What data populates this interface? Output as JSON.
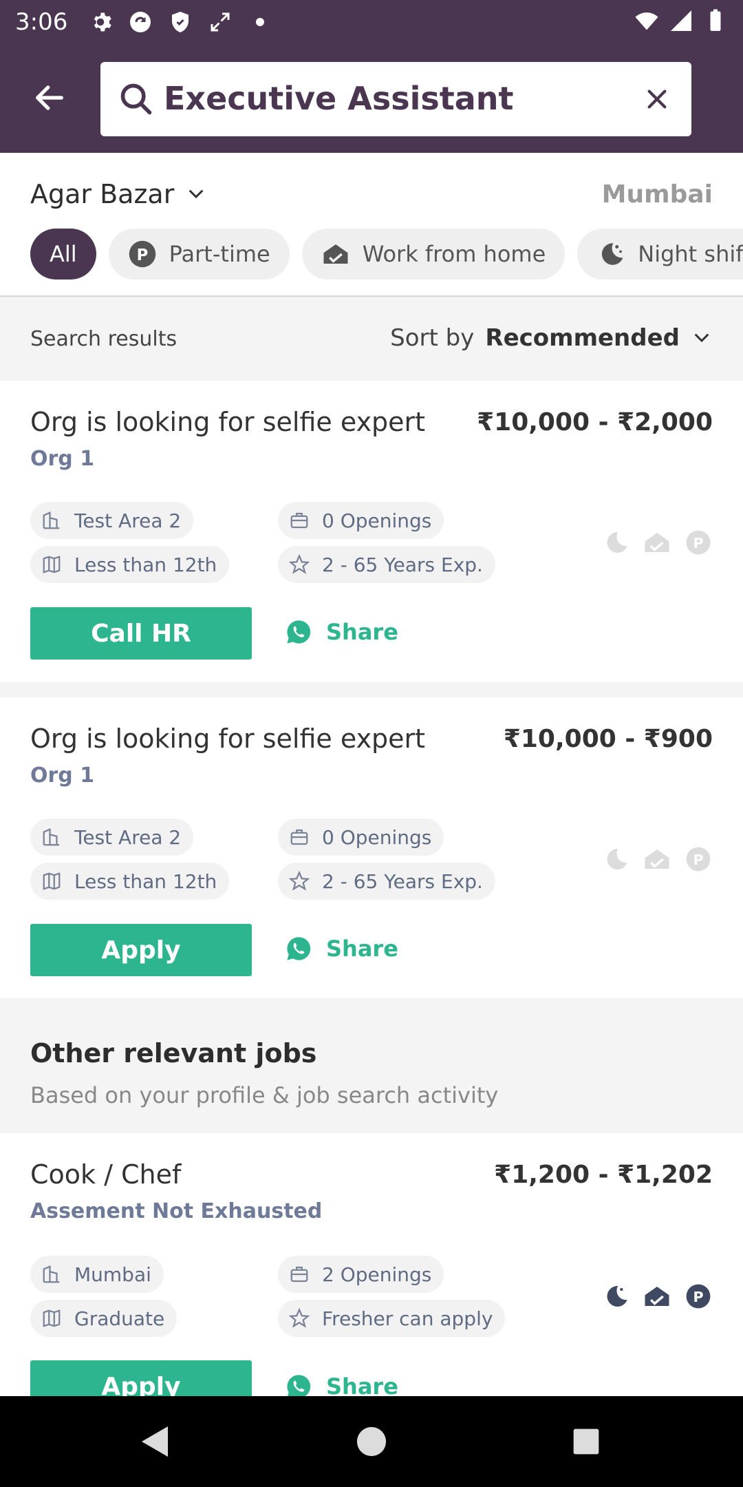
{
  "status": {
    "time": "3:06"
  },
  "search": {
    "query": "Executive Assistant"
  },
  "location": {
    "area": "Agar Bazar",
    "city": "Mumbai"
  },
  "filters": [
    {
      "label": "All",
      "icon": "none",
      "active": true
    },
    {
      "label": "Part-time",
      "icon": "part-time-icon",
      "active": false
    },
    {
      "label": "Work from home",
      "icon": "home-icon",
      "active": false
    },
    {
      "label": "Night shift",
      "icon": "night-icon",
      "active": false
    }
  ],
  "results": {
    "label": "Search results",
    "sort_prefix": "Sort by",
    "sort_value": "Recommended"
  },
  "jobs": [
    {
      "title": "Org is looking for selfie expert",
      "org": "Org 1",
      "salary": "₹10,000 - ₹2,000",
      "area": "Test Area 2",
      "openings": "0 Openings",
      "education": "Less than 12th",
      "experience": "2 - 65 Years Exp.",
      "action": "Call HR",
      "share": "Share",
      "features_active": false
    },
    {
      "title": "Org is looking for selfie expert",
      "org": "Org 1",
      "salary": "₹10,000 - ₹900",
      "area": "Test Area 2",
      "openings": "0 Openings",
      "education": "Less than 12th",
      "experience": "2 - 65 Years Exp.",
      "action": "Apply",
      "share": "Share",
      "features_active": false
    }
  ],
  "other": {
    "title": "Other relevant jobs",
    "subtitle": "Based on your profile & job search activity",
    "job": {
      "title": "Cook / Chef",
      "org": "Assement Not Exhausted",
      "salary": "₹1,200 - ₹1,202",
      "area": "Mumbai",
      "openings": "2 Openings",
      "education": "Graduate",
      "experience": "Fresher can apply",
      "action": "Apply",
      "share": "Share",
      "features_active": true
    }
  },
  "colors": {
    "brand": "#4a3650",
    "accent": "#2db58f",
    "org": "#6f7a98"
  }
}
